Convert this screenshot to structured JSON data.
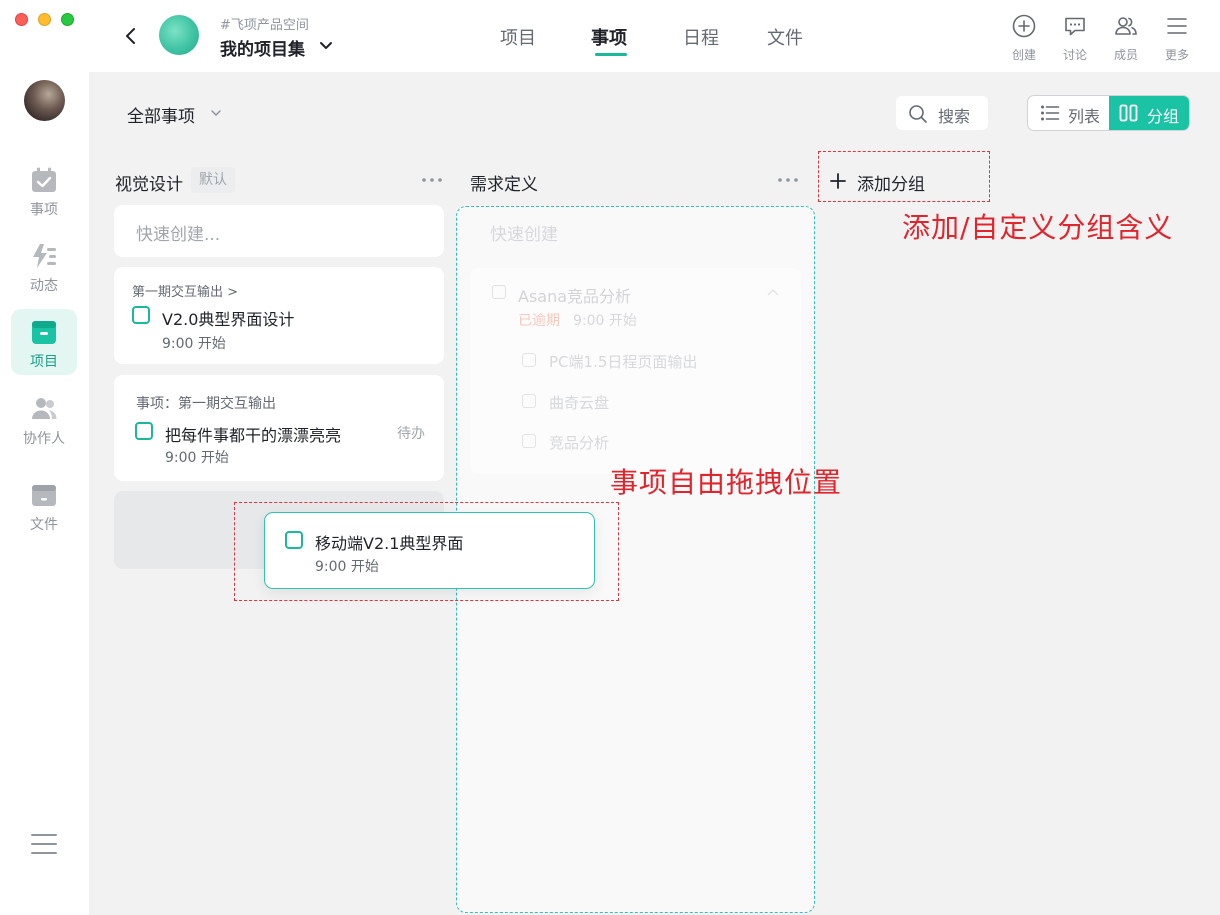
{
  "header": {
    "space_name": "#飞项产品空间",
    "project_name": "我的项目集",
    "tabs": [
      {
        "label": "项目"
      },
      {
        "label": "事项"
      },
      {
        "label": "日程"
      },
      {
        "label": "文件"
      }
    ],
    "tools": [
      {
        "label": "创建",
        "icon": "plus-circle-icon"
      },
      {
        "label": "讨论",
        "icon": "chat-icon"
      },
      {
        "label": "成员",
        "icon": "members-icon"
      },
      {
        "label": "更多",
        "icon": "menu-icon"
      }
    ]
  },
  "sidebar": {
    "items": [
      {
        "label": "事项",
        "icon": "calendar-check-icon"
      },
      {
        "label": "动态",
        "icon": "activity-icon"
      },
      {
        "label": "项目",
        "icon": "project-icon",
        "active": true
      },
      {
        "label": "协作人",
        "icon": "people-icon"
      },
      {
        "label": "文件",
        "icon": "file-box-icon"
      }
    ]
  },
  "toolbar": {
    "filter": "全部事项",
    "search": "搜索",
    "view_list": "列表",
    "view_group": "分组"
  },
  "columns": [
    {
      "title": "视觉设计",
      "badge": "默认",
      "quick_create": "快速创建...",
      "cards": [
        {
          "crumb": "第一期交互输出 >",
          "name": "V2.0典型界面设计",
          "time": "9:00 开始"
        },
        {
          "crumb": "事项：第一期交互输出",
          "name": "把每件事都干的漂漂亮亮",
          "time": "9:00 开始",
          "status": "待办"
        }
      ]
    },
    {
      "title": "需求定义",
      "quick_create": "快速创建",
      "ghost_card": {
        "name": "Asana竞品分析",
        "overdue": "已逾期",
        "time": "9:00 开始",
        "subtasks": [
          "PC端1.5日程页面输出",
          "曲奇云盘",
          "竞品分析"
        ]
      }
    }
  ],
  "add_group": "添加分组",
  "dragging_card": {
    "name": "移动端V2.1典型界面",
    "time": "9:00 开始"
  },
  "annotations": {
    "add_group_note": "添加/自定义分组含义",
    "drag_note": "事项自由拖拽位置"
  },
  "colors": {
    "accent": "#19c3a3",
    "annotation": "#e0262d"
  }
}
